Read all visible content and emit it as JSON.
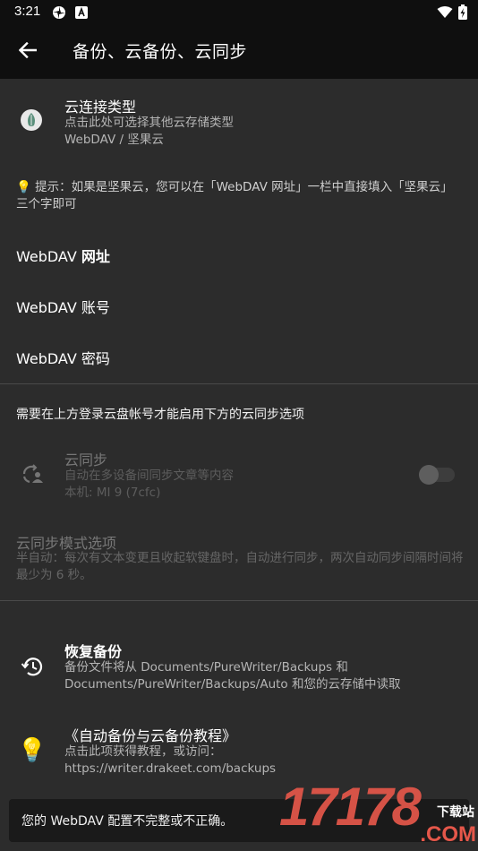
{
  "status_bar": {
    "time": "3:21",
    "icons": [
      "pinwheel-icon",
      "a-box-icon",
      "wifi-icon",
      "battery-charging-icon"
    ]
  },
  "app_bar": {
    "back_icon": "arrow-left-icon",
    "title": "备份、云备份、云同步"
  },
  "cloud_type": {
    "icon": "nut-icon",
    "title": "云连接类型",
    "subtitle": "点击此处可选择其他云存储类型",
    "value": "WebDAV / 坚果云"
  },
  "hint": {
    "icon": "lightbulb-icon",
    "icon_glyph": "💡",
    "text": "提示：如果是坚果云，您可以在「WebDAV 网址」一栏中直接填入「坚果云」三个字即可"
  },
  "webdav": {
    "url_label_prefix": "WebDAV ",
    "url_label_bold": "网址",
    "account_label": "WebDAV 账号",
    "password_label": "WebDAV 密码"
  },
  "sync_notice": "需要在上方登录云盘帐号才能启用下方的云同步选项",
  "cloud_sync": {
    "icon": "sync-user-icon",
    "title": "云同步",
    "subtitle": "自动在多设备间同步文章等内容",
    "device": "本机: MI 9 (7cfc)",
    "enabled": false
  },
  "sync_mode": {
    "title": "云同步模式选项",
    "description": "半自动：每次有文本变更且收起软键盘时，自动进行同步，两次自动同步间隔时间将最少为 6 秒。"
  },
  "restore": {
    "icon": "history-icon",
    "title": "恢复备份",
    "description": "备份文件将从 Documents/PureWriter/Backups 和 Documents/PureWriter/Backups/Auto 和您的云存储中读取"
  },
  "tutorial": {
    "icon": "lightbulb-icon",
    "icon_glyph": "💡",
    "title": "《自动备份与云备份教程》",
    "subtitle": "点击此项获得教程，或访问：",
    "url": "https://writer.drakeet.com/backups"
  },
  "snackbar": {
    "message": "您的 WebDAV 配置不完整或不正确。"
  },
  "watermark": {
    "digits": "17178",
    "site": "下载站",
    "domain": ".COM"
  },
  "colors": {
    "background": "#2c2c2c",
    "bar": "#0f0f0f",
    "watermark_red": "#e5574a"
  }
}
